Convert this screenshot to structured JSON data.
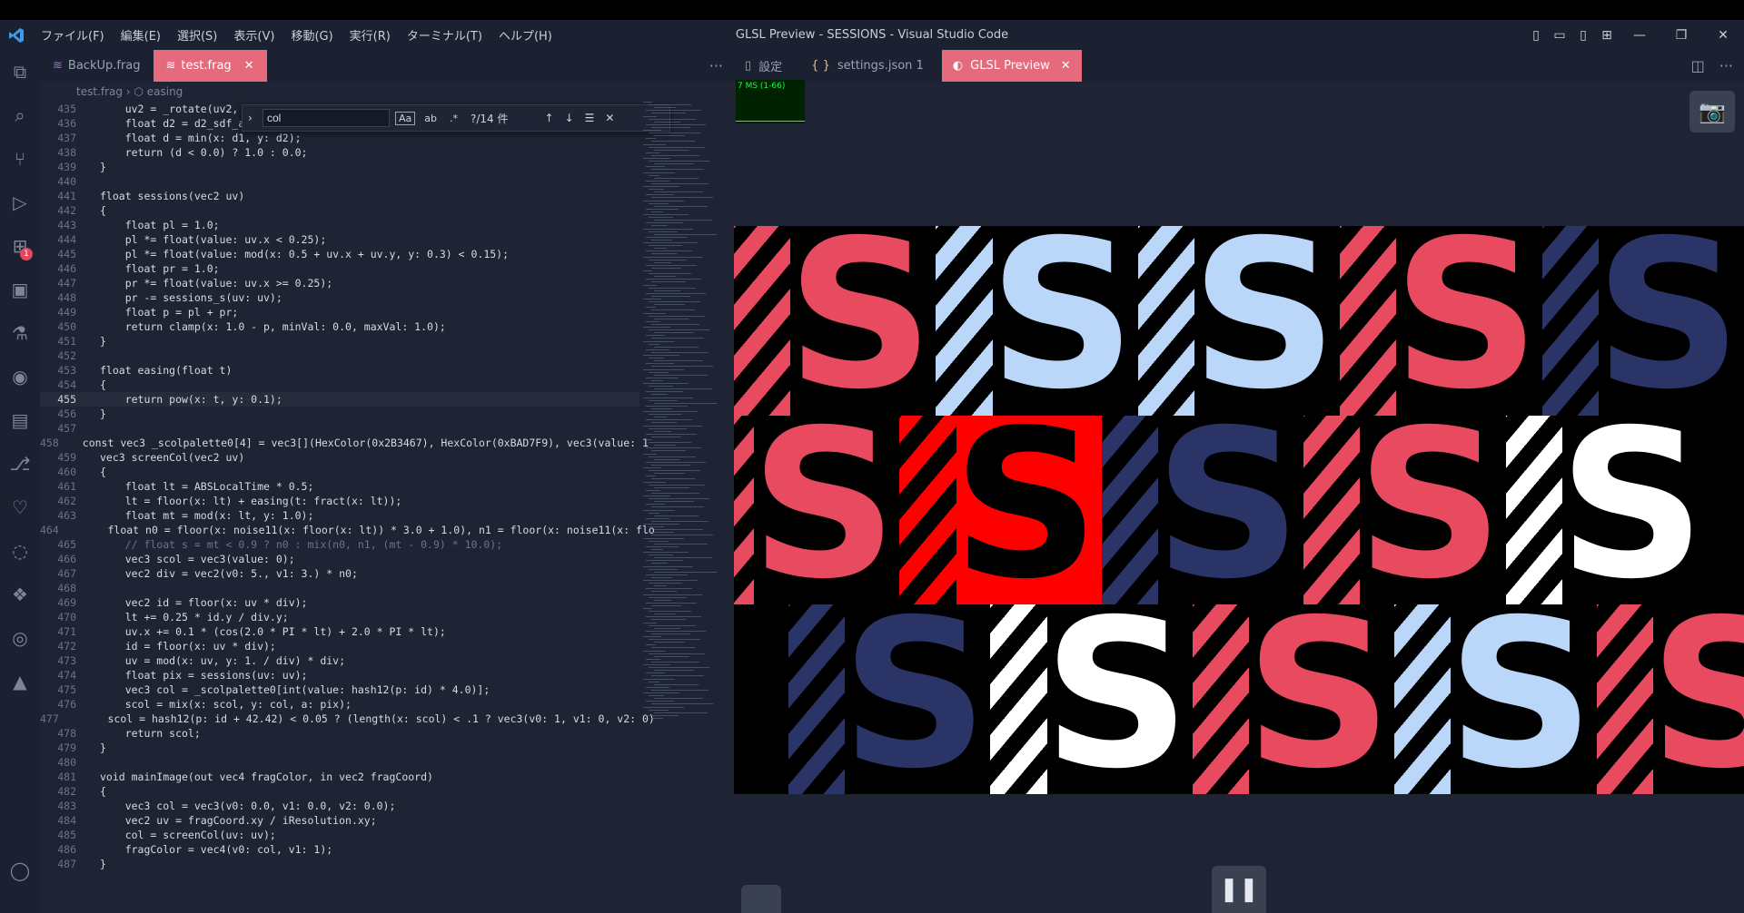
{
  "window": {
    "title": "GLSL Preview - SESSIONS - Visual Studio Code",
    "menu": [
      "ファイル(F)",
      "編集(E)",
      "選択(S)",
      "表示(V)",
      "移動(G)",
      "実行(R)",
      "ターミナル(T)",
      "ヘルプ(H)"
    ]
  },
  "activity_bar": {
    "extensions_badge": "1",
    "icons": [
      "explorer-icon",
      "search-icon",
      "source-control-icon",
      "run-debug-icon",
      "extensions-icon",
      "remote-explorer-icon",
      "testing-icon",
      "github-icon",
      "terminal-icon",
      "git-graph-icon",
      "timeline-icon",
      "json-icon",
      "python-icon",
      "record-icon",
      "azure-icon",
      "account-icon",
      "settings-gear-icon"
    ]
  },
  "editor": {
    "tabs": [
      {
        "label": "BackUp.frag",
        "active": false
      },
      {
        "label": "test.frag",
        "active": true
      }
    ],
    "breadcrumb": {
      "file": "test.frag",
      "symbol": "easing"
    },
    "find": {
      "query": "col",
      "result": "?/14 件",
      "opt_case": "Aa",
      "opt_word": "ab",
      "opt_regex": ".*"
    },
    "lines": [
      {
        "n": "435",
        "code": "    uv2 = _rotate(uv2,"
      },
      {
        "n": "436",
        "code": "    float d2 = d2_sdf_a"
      },
      {
        "n": "437",
        "code": "    float d = min(x: d1, y: d2);"
      },
      {
        "n": "438",
        "code": "    return (d < 0.0) ? 1.0 : 0.0;"
      },
      {
        "n": "439",
        "code": "}"
      },
      {
        "n": "440",
        "code": ""
      },
      {
        "n": "441",
        "code": "float sessions(vec2 uv)"
      },
      {
        "n": "442",
        "code": "{"
      },
      {
        "n": "443",
        "code": "    float pl = 1.0;"
      },
      {
        "n": "444",
        "code": "    pl *= float(value: uv.x < 0.25);"
      },
      {
        "n": "445",
        "code": "    pl *= float(value: mod(x: 0.5 + uv.x + uv.y, y: 0.3) < 0.15);"
      },
      {
        "n": "446",
        "code": "    float pr = 1.0;"
      },
      {
        "n": "447",
        "code": "    pr *= float(value: uv.x >= 0.25);"
      },
      {
        "n": "448",
        "code": "    pr -= sessions_s(uv: uv);"
      },
      {
        "n": "449",
        "code": "    float p = pl + pr;"
      },
      {
        "n": "450",
        "code": "    return clamp(x: 1.0 - p, minVal: 0.0, maxVal: 1.0);"
      },
      {
        "n": "451",
        "code": "}"
      },
      {
        "n": "452",
        "code": ""
      },
      {
        "n": "453",
        "code": "float easing(float t)"
      },
      {
        "n": "454",
        "code": "{"
      },
      {
        "n": "455",
        "code": "    return pow(x: t, y: 0.1);"
      },
      {
        "n": "456",
        "code": "}"
      },
      {
        "n": "457",
        "code": ""
      },
      {
        "n": "458",
        "code": "const vec3 _scolpalette0[4] = vec3[](HexColor(0x2B3467), HexColor(0xBAD7F9), vec3(value: 1"
      },
      {
        "n": "459",
        "code": "vec3 screenCol(vec2 uv)"
      },
      {
        "n": "460",
        "code": "{"
      },
      {
        "n": "461",
        "code": "    float lt = ABSLocalTime * 0.5;"
      },
      {
        "n": "462",
        "code": "    lt = floor(x: lt) + easing(t: fract(x: lt));"
      },
      {
        "n": "463",
        "code": "    float mt = mod(x: lt, y: 1.0);"
      },
      {
        "n": "464",
        "code": "    float n0 = floor(x: noise11(x: floor(x: lt)) * 3.0 + 1.0), n1 = floor(x: noise11(x: flo"
      },
      {
        "n": "465",
        "code": "    // float s = mt < 0.9 ? n0 : mix(n0, n1, (mt - 0.9) * 10.0);"
      },
      {
        "n": "466",
        "code": "    vec3 scol = vec3(value: 0);"
      },
      {
        "n": "467",
        "code": "    vec2 div = vec2(v0: 5., v1: 3.) * n0;"
      },
      {
        "n": "468",
        "code": ""
      },
      {
        "n": "469",
        "code": "    vec2 id = floor(x: uv * div);"
      },
      {
        "n": "470",
        "code": "    lt += 0.25 * id.y / div.y;"
      },
      {
        "n": "471",
        "code": "    uv.x += 0.1 * (cos(2.0 * PI * lt) + 2.0 * PI * lt);"
      },
      {
        "n": "472",
        "code": "    id = floor(x: uv * div);"
      },
      {
        "n": "473",
        "code": "    uv = mod(x: uv, y: 1. / div) * div;"
      },
      {
        "n": "474",
        "code": "    float pix = sessions(uv: uv);"
      },
      {
        "n": "475",
        "code": "    vec3 col = _scolpalette0[int(value: hash12(p: id) * 4.0)];"
      },
      {
        "n": "476",
        "code": "    scol = mix(x: scol, y: col, a: pix);"
      },
      {
        "n": "477",
        "code": "    scol = hash12(p: id + 42.42) < 0.05 ? (length(x: scol) < .1 ? vec3(v0: 1, v1: 0, v2: 0)"
      },
      {
        "n": "478",
        "code": "    return scol;"
      },
      {
        "n": "479",
        "code": "}"
      },
      {
        "n": "480",
        "code": ""
      },
      {
        "n": "481",
        "code": "void mainImage(out vec4 fragColor, in vec2 fragCoord)"
      },
      {
        "n": "482",
        "code": "{"
      },
      {
        "n": "483",
        "code": "    vec3 col = vec3(v0: 0.0, v1: 0.0, v2: 0.0);"
      },
      {
        "n": "484",
        "code": "    vec2 uv = fragCoord.xy / iResolution.xy;"
      },
      {
        "n": "485",
        "code": "    col = screenCol(uv: uv);"
      },
      {
        "n": "486",
        "code": "    fragColor = vec4(v0: col, v1: 1);"
      },
      {
        "n": "487",
        "code": "}"
      }
    ],
    "current_line": "455"
  },
  "preview": {
    "tabs": [
      {
        "label": "設定",
        "icon": "settings-file-icon",
        "active": false
      },
      {
        "label": "settings.json 1",
        "icon": "json-braces-icon",
        "active": false
      },
      {
        "label": "GLSL Preview",
        "icon": "preview-icon",
        "active": true
      }
    ],
    "perf": "7 MS (1-66)",
    "letter": "S",
    "colors": {
      "navy": "#2B3467",
      "light": "#BAD7F9",
      "pink": "#E84A5F",
      "white": "#FFFFFF",
      "red": "#FF0000"
    },
    "tiles": [
      {
        "color": "pink"
      },
      {
        "color": "light"
      },
      {
        "color": "light"
      },
      {
        "color": "pink"
      },
      {
        "color": "navy"
      },
      {
        "color": "pink"
      },
      {
        "color": "red-black"
      },
      {
        "color": "navy"
      },
      {
        "color": "pink"
      },
      {
        "color": "white"
      },
      {
        "color": "navy"
      },
      {
        "color": "white"
      },
      {
        "color": "pink"
      },
      {
        "color": "light"
      },
      {
        "color": "pink"
      }
    ]
  }
}
